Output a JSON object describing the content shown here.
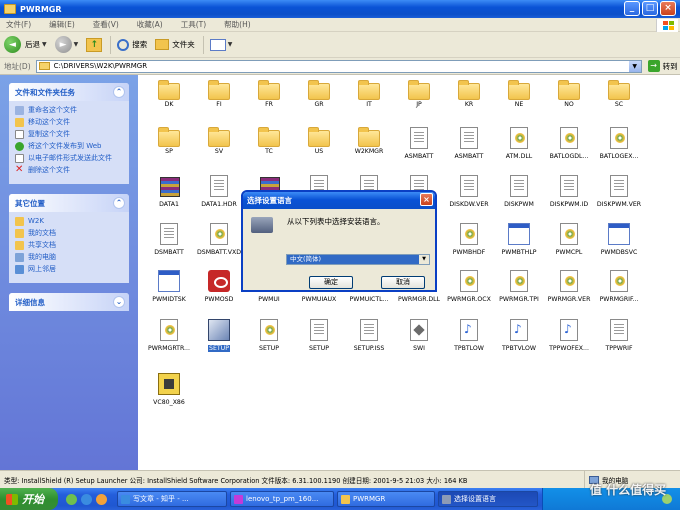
{
  "window": {
    "title": "PWRMGR",
    "colors": {
      "titlebar": "#0a53d6",
      "accent": "#316ac5",
      "leftpane": "#6375d6"
    }
  },
  "menu": [
    "文件(F)",
    "编辑(E)",
    "查看(V)",
    "收藏(A)",
    "工具(T)",
    "帮助(H)"
  ],
  "toolbar": {
    "back": "后退",
    "search": "搜索",
    "folders": "文件夹"
  },
  "address": {
    "label": "地址(D)",
    "path": "C:\\DRIVERS\\W2K\\PWRMGR",
    "go": "转到"
  },
  "sidebar": {
    "tasks": {
      "title": "文件和文件夹任务",
      "items": [
        {
          "label": "重命名这个文件",
          "icon": "rename-icon"
        },
        {
          "label": "移动这个文件",
          "icon": "move-icon"
        },
        {
          "label": "复制这个文件",
          "icon": "copy-icon"
        },
        {
          "label": "将这个文件发布到 Web",
          "icon": "web-publish-icon"
        },
        {
          "label": "以电子邮件形式发送此文件",
          "icon": "email-icon"
        },
        {
          "label": "删除这个文件",
          "icon": "delete-icon"
        }
      ]
    },
    "places": {
      "title": "其它位置",
      "items": [
        {
          "label": "W2K",
          "icon": "folder-icon"
        },
        {
          "label": "我的文档",
          "icon": "my-documents-icon"
        },
        {
          "label": "共享文档",
          "icon": "shared-documents-icon"
        },
        {
          "label": "我的电脑",
          "icon": "my-computer-icon"
        },
        {
          "label": "网上邻居",
          "icon": "network-icon"
        }
      ]
    },
    "details": {
      "title": "详细信息"
    }
  },
  "files": [
    {
      "name": "DK",
      "type": "folder"
    },
    {
      "name": "FI",
      "type": "folder"
    },
    {
      "name": "FR",
      "type": "folder"
    },
    {
      "name": "GR",
      "type": "folder"
    },
    {
      "name": "IT",
      "type": "folder"
    },
    {
      "name": "JP",
      "type": "folder"
    },
    {
      "name": "KR",
      "type": "folder"
    },
    {
      "name": "NE",
      "type": "folder"
    },
    {
      "name": "NO",
      "type": "folder"
    },
    {
      "name": "SC",
      "type": "folder"
    },
    {
      "name": "SP",
      "type": "folder"
    },
    {
      "name": "SV",
      "type": "folder"
    },
    {
      "name": "TC",
      "type": "folder"
    },
    {
      "name": "US",
      "type": "folder"
    },
    {
      "name": "W2KMGR",
      "type": "folder"
    },
    {
      "name": "ASMBATT",
      "type": "doc"
    },
    {
      "name": "ASMBATT",
      "type": "doc"
    },
    {
      "name": "ATM.DLL",
      "type": "gear"
    },
    {
      "name": "BATLOGDL...",
      "type": "gear"
    },
    {
      "name": "BATLOGEX...",
      "type": "gear"
    },
    {
      "name": "DATA1",
      "type": "rar"
    },
    {
      "name": "DATA1.HDR",
      "type": "doc"
    },
    {
      "name": "DATA2",
      "type": "rar"
    },
    {
      "name": "",
      "type": "doc"
    },
    {
      "name": "",
      "type": "doc"
    },
    {
      "name": "",
      "type": "doc"
    },
    {
      "name": "DISKDW.VER",
      "type": "doc"
    },
    {
      "name": "DISKPWM",
      "type": "doc"
    },
    {
      "name": "DISKPWM.ID",
      "type": "doc"
    },
    {
      "name": "DISKPWM.VER",
      "type": "doc"
    },
    {
      "name": "DSMBATT",
      "type": "doc"
    },
    {
      "name": "DSMBATT.VXD",
      "type": "gear"
    },
    {
      "name": "",
      "type": "doc"
    },
    {
      "name": "",
      "type": "doc"
    },
    {
      "name": "",
      "type": "doc"
    },
    {
      "name": "",
      "type": "doc"
    },
    {
      "name": "PWMBHDF",
      "type": "gear"
    },
    {
      "name": "PWMBTHLP",
      "type": "window"
    },
    {
      "name": "PWMCPL",
      "type": "gear"
    },
    {
      "name": "PWMDBSVC",
      "type": "window"
    },
    {
      "name": "PWMIDTSK",
      "type": "window"
    },
    {
      "name": "PWMOSD",
      "type": "red"
    },
    {
      "name": "PWMUI",
      "type": "gear"
    },
    {
      "name": "PWMUIAUX",
      "type": "window"
    },
    {
      "name": "PWMUICTL...",
      "type": "gear"
    },
    {
      "name": "PWRMGR.DLL",
      "type": "gear"
    },
    {
      "name": "PWRMGR.OCX",
      "type": "gear"
    },
    {
      "name": "PWRMGR.TPI",
      "type": "gear"
    },
    {
      "name": "PWRMGR.VER",
      "type": "gear"
    },
    {
      "name": "PWRMGRIF...",
      "type": "gear"
    },
    {
      "name": "PWRMGRTR...",
      "type": "gear"
    },
    {
      "name": "SETUP",
      "type": "setup",
      "selected": true
    },
    {
      "name": "SETUP",
      "type": "gear"
    },
    {
      "name": "SETUP",
      "type": "doc"
    },
    {
      "name": "SETUP.ISS",
      "type": "doc"
    },
    {
      "name": "SWI",
      "type": "sys"
    },
    {
      "name": "TPBTLOW",
      "type": "wav"
    },
    {
      "name": "TPBTVLOW",
      "type": "wav"
    },
    {
      "name": "TPPWOFEX...",
      "type": "wav"
    },
    {
      "name": "TPPWRIF",
      "type": "doc"
    },
    {
      "name": "VC80_X86",
      "type": "vc"
    }
  ],
  "dialog": {
    "title": "选择设置语言",
    "message": "从以下列表中选择安装语言。",
    "selected_language": "中文(简体)",
    "ok": "确定",
    "cancel": "取消"
  },
  "status": {
    "text": "类型: InstallShield (R) Setup Launcher 公司: InstallShield Software Corporation 文件版本: 6.31.100.1190 创建日期: 2001-9-5 21:03 大小: 164 KB",
    "location": "我的电脑"
  },
  "taskbar": {
    "start": "开始",
    "tasks": [
      {
        "label": "写文章 - 知乎 - ..."
      },
      {
        "label": "lenovo_tp_pm_160..."
      },
      {
        "label": "PWRMGR"
      },
      {
        "label": "选择设置语言",
        "active": true
      }
    ],
    "watermark": "值 什么值得买"
  }
}
